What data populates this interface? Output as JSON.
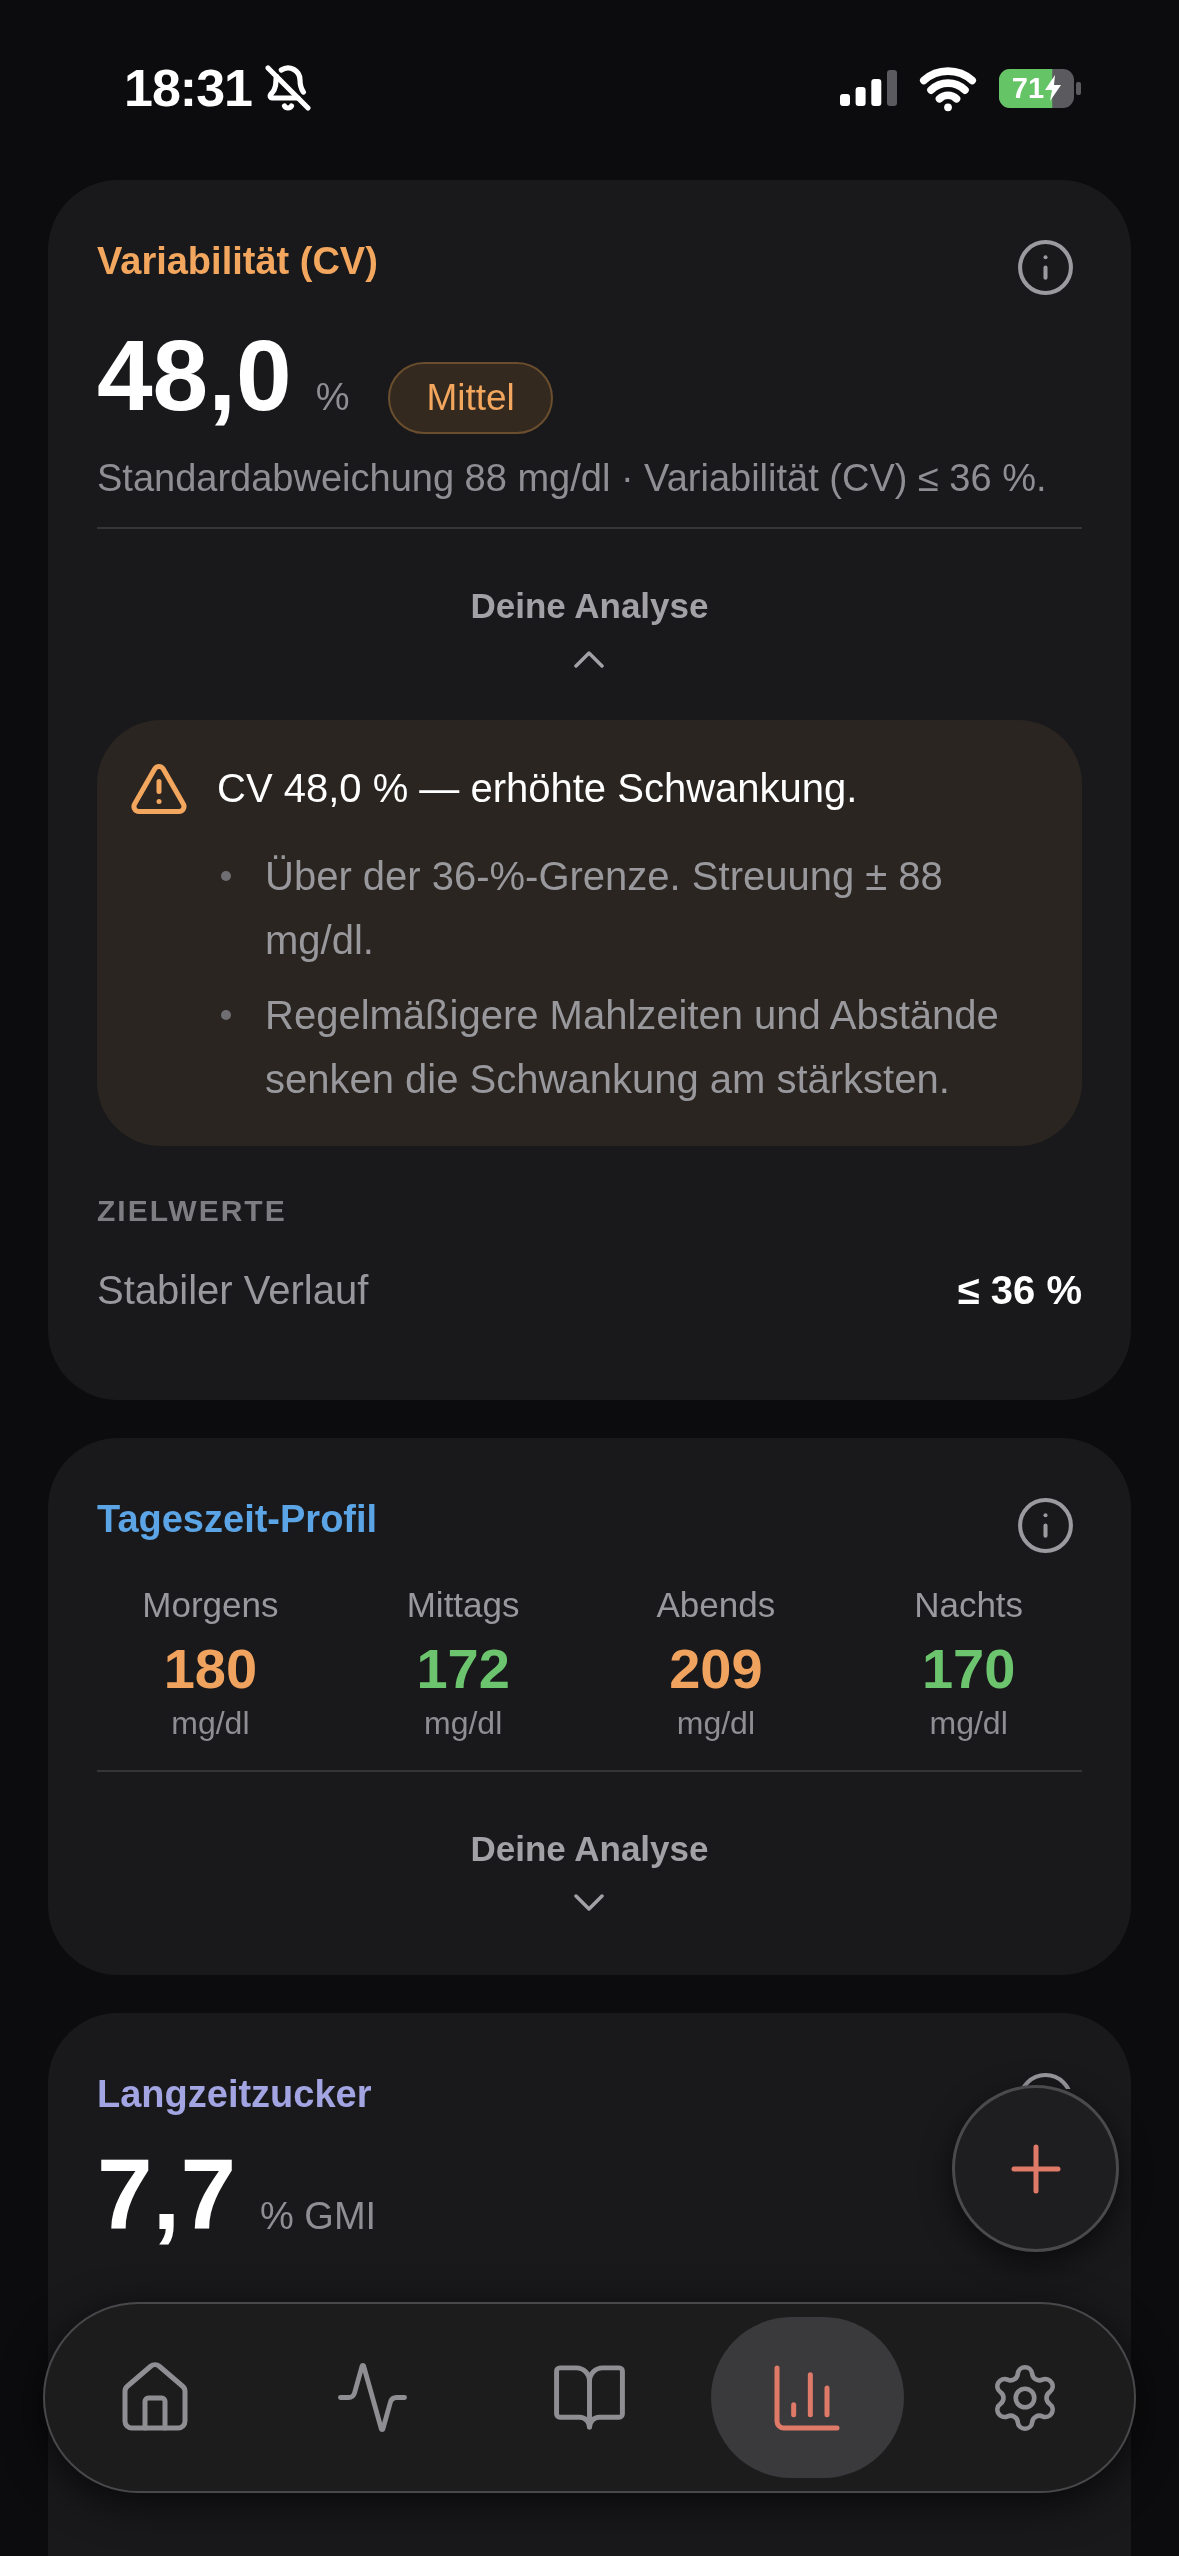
{
  "status_bar": {
    "time": "18:31",
    "silent": true,
    "battery": "71",
    "charging": true
  },
  "cards": [
    {
      "kind": "metric",
      "title": "Variabilität (CV)",
      "color": "#f2a65e",
      "value": "48,0",
      "unit": "%",
      "badge": "Mittel",
      "subtitle": "Standardabweichung 88 mg/dl · Variabilität (CV) ≤ 36 %.",
      "analysis": {
        "label": "Deine Analyse",
        "expanded": true,
        "title": "CV 48,0 % — erhöhte Schwankung.",
        "points": [
          "Über der 36-%-Grenze. Streuung ± 88 mg/dl.",
          "Regelmäßigere Mahlzeiten und Abstände senken die Schwankung am stärksten."
        ]
      },
      "targets": {
        "heading": "ZIELWERTE",
        "rows": [
          {
            "label": "Stabiler Verlauf",
            "value": "≤ 36 %"
          }
        ]
      }
    },
    {
      "kind": "profile",
      "title": "Tageszeit-Profil",
      "color": "#5ba4e5",
      "periods": [
        {
          "label": "Morgens",
          "value": "180",
          "unit": "mg/dl",
          "color": "#f0a35e"
        },
        {
          "label": "Mittags",
          "value": "172",
          "unit": "mg/dl",
          "color": "#6cc56e"
        },
        {
          "label": "Abends",
          "value": "209",
          "unit": "mg/dl",
          "color": "#f0a35e"
        },
        {
          "label": "Nachts",
          "value": "170",
          "unit": "mg/dl",
          "color": "#6cc56e"
        }
      ],
      "analysis": {
        "label": "Deine Analyse",
        "expanded": false
      }
    },
    {
      "kind": "metric",
      "title": "Langzeitzucker",
      "color": "#a3a5e3",
      "value": "7,7",
      "unit": "% GMI"
    }
  ],
  "nav": {
    "items": [
      {
        "selected": false
      },
      {
        "selected": false
      },
      {
        "selected": false
      },
      {
        "selected": true
      },
      {
        "selected": false
      }
    ]
  }
}
